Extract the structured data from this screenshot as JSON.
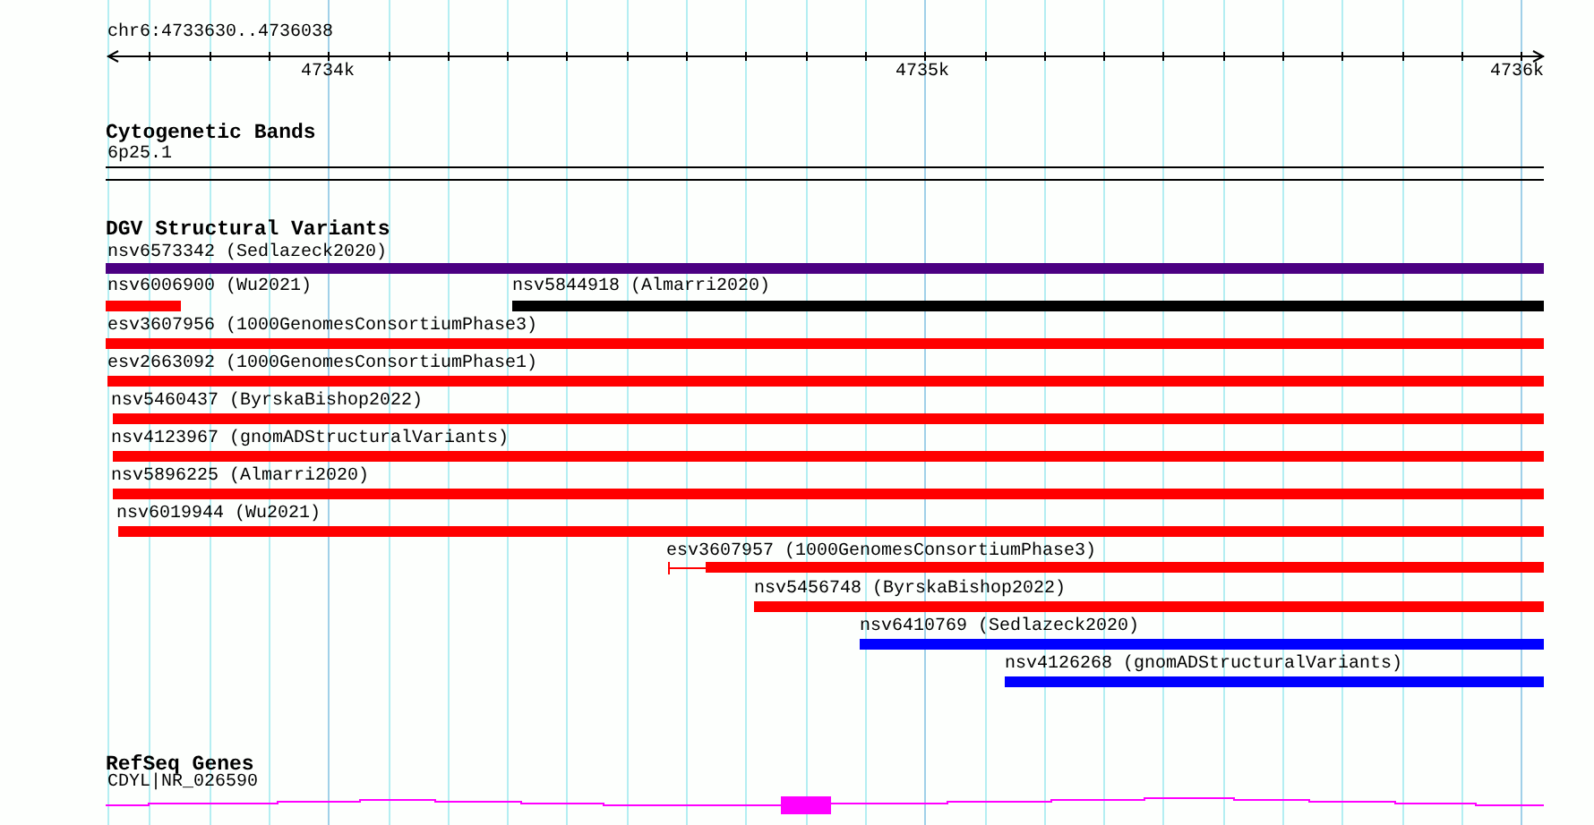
{
  "ruler": {
    "location": "chr6:4733630..4736038",
    "ticks": [
      "4734k",
      "4735k",
      "4736k"
    ]
  },
  "tracks": [
    {
      "kind": "bands",
      "title": "Cytogenetic Bands",
      "features": [
        {
          "label": "6p25.1"
        }
      ]
    },
    {
      "kind": "variants",
      "title": "DGV Structural Variants",
      "features": [
        {
          "label": "nsv6573342 (Sedlazeck2020)",
          "color": "#4b0082"
        },
        {
          "label": "nsv6006900 (Wu2021)",
          "color": "#ff0000"
        },
        {
          "label": "nsv5844918 (Almarri2020)",
          "color": "#000000"
        },
        {
          "label": "esv3607956 (1000GenomesConsortiumPhase3)",
          "color": "#ff0000"
        },
        {
          "label": "esv2663092 (1000GenomesConsortiumPhase1)",
          "color": "#ff0000"
        },
        {
          "label": "nsv5460437 (ByrskaBishop2022)",
          "color": "#ff0000"
        },
        {
          "label": "nsv4123967 (gnomADStructuralVariants)",
          "color": "#ff0000"
        },
        {
          "label": "nsv5896225 (Almarri2020)",
          "color": "#ff0000"
        },
        {
          "label": "nsv6019944 (Wu2021)",
          "color": "#ff0000"
        },
        {
          "label": "esv3607957 (1000GenomesConsortiumPhase3)",
          "color": "#ff0000"
        },
        {
          "label": "nsv5456748 (ByrskaBishop2022)",
          "color": "#ff0000"
        },
        {
          "label": "nsv6410769 (Sedlazeck2020)",
          "color": "#0000ff"
        },
        {
          "label": "nsv4126268 (gnomADStructuralVariants)",
          "color": "#0000ff"
        }
      ]
    },
    {
      "kind": "genes",
      "title": "RefSeq Genes",
      "features": [
        {
          "label": "CDYL|NR_026590",
          "color": "#ff00ff"
        }
      ]
    }
  ]
}
